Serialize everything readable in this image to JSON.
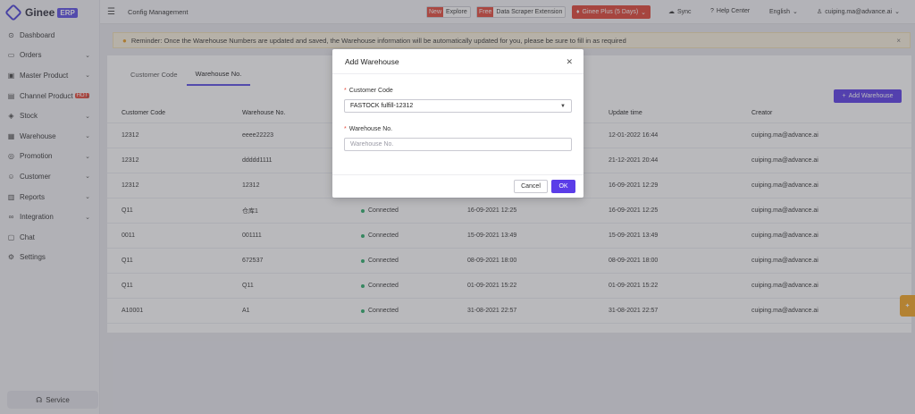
{
  "app": {
    "logo_text": "Ginee",
    "logo_badge": "ERP"
  },
  "sidebar": {
    "items": [
      {
        "label": "Dashboard",
        "icon": "⊙",
        "chevron": false
      },
      {
        "label": "Orders",
        "icon": "▭",
        "chevron": true
      },
      {
        "label": "Master Product",
        "icon": "▣",
        "chevron": true
      },
      {
        "label": "Channel Product",
        "icon": "▤",
        "chevron": true,
        "badge": "HOT"
      },
      {
        "label": "Stock",
        "icon": "◈",
        "chevron": true
      },
      {
        "label": "Warehouse",
        "icon": "▦",
        "chevron": true
      },
      {
        "label": "Promotion",
        "icon": "◎",
        "chevron": true
      },
      {
        "label": "Customer",
        "icon": "☺",
        "chevron": true
      },
      {
        "label": "Reports",
        "icon": "▥",
        "chevron": true
      },
      {
        "label": "Integration",
        "icon": "∞",
        "chevron": true
      },
      {
        "label": "Chat",
        "icon": "▢",
        "chevron": false
      },
      {
        "label": "Settings",
        "icon": "⚙",
        "chevron": false
      }
    ],
    "service_label": "Service"
  },
  "header": {
    "page_title": "Config Management",
    "explore_tag": "New",
    "explore_label": "Explore",
    "scraper_tag": "Free",
    "scraper_label": "Data Scraper Extension",
    "plus_label": "Ginee Plus (5 Days)",
    "sync_label": "Sync",
    "help_label": "Help Center",
    "language": "English",
    "user": "cuiping.ma@advance.ai"
  },
  "banner": {
    "text": "Reminder: Once the Warehouse Numbers are updated and saved, the Warehouse information will be automatically updated for you, please be sure to fill in as required"
  },
  "tabs": [
    {
      "label": "Customer Code",
      "active": false
    },
    {
      "label": "Warehouse No.",
      "active": true
    }
  ],
  "add_button_label": "Add Warehouse",
  "table": {
    "columns": [
      "Customer Code",
      "Warehouse No.",
      "",
      "",
      "Update time",
      "Creator"
    ],
    "rows": [
      {
        "customer_code": "12312",
        "warehouse_no": "eeee22223",
        "status": "",
        "created": "",
        "updated": "12-01-2022 16:44",
        "creator": "cuiping.ma@advance.ai"
      },
      {
        "customer_code": "12312",
        "warehouse_no": "ddddd1111",
        "status": "",
        "created": "",
        "updated": "21-12-2021 20:44",
        "creator": "cuiping.ma@advance.ai"
      },
      {
        "customer_code": "12312",
        "warehouse_no": "12312",
        "status": "",
        "created": "",
        "updated": "16-09-2021 12:29",
        "creator": "cuiping.ma@advance.ai"
      },
      {
        "customer_code": "Q11",
        "warehouse_no": "仓库1",
        "status": "Connected",
        "created": "16-09-2021 12:25",
        "updated": "16-09-2021 12:25",
        "creator": "cuiping.ma@advance.ai"
      },
      {
        "customer_code": "0011",
        "warehouse_no": "001111",
        "status": "Connected",
        "created": "15-09-2021 13:49",
        "updated": "15-09-2021 13:49",
        "creator": "cuiping.ma@advance.ai"
      },
      {
        "customer_code": "Q11",
        "warehouse_no": "672537",
        "status": "Connected",
        "created": "08-09-2021 18:00",
        "updated": "08-09-2021 18:00",
        "creator": "cuiping.ma@advance.ai"
      },
      {
        "customer_code": "Q11",
        "warehouse_no": "Q11",
        "status": "Connected",
        "created": "01-09-2021 15:22",
        "updated": "01-09-2021 15:22",
        "creator": "cuiping.ma@advance.ai"
      },
      {
        "customer_code": "A10001",
        "warehouse_no": "A1",
        "status": "Connected",
        "created": "31-08-2021 22:57",
        "updated": "31-08-2021 22:57",
        "creator": "cuiping.ma@advance.ai"
      }
    ]
  },
  "modal": {
    "title": "Add Warehouse",
    "customer_code_label": "Customer Code",
    "customer_code_value": "FASTOCK fulfill-12312",
    "warehouse_no_label": "Warehouse No.",
    "warehouse_no_placeholder": "Warehouse No.",
    "warehouse_no_value": "",
    "cancel_label": "Cancel",
    "ok_label": "OK"
  },
  "colors": {
    "accent": "#5b3de8",
    "danger": "#e14536",
    "warning_bg": "#fbf3df",
    "connected": "#2dae6b",
    "help_float": "#f6a623"
  }
}
